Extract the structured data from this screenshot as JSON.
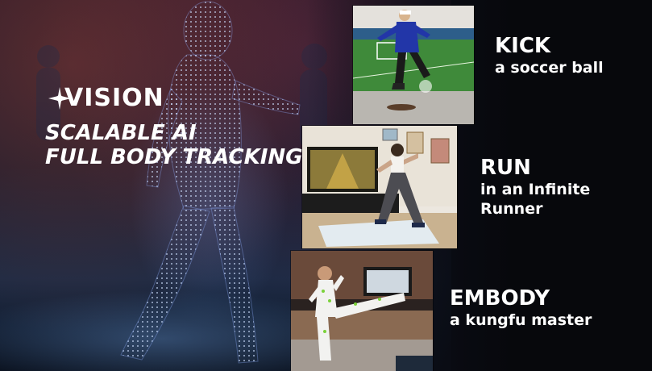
{
  "brand": {
    "logo_text": "VISION",
    "logo_icon": "sparkle-icon"
  },
  "tagline": {
    "line1": "SCALABLE AI",
    "line2": "FULL BODY TRACKING"
  },
  "activities": [
    {
      "title": "KICK",
      "subtitle_lines": [
        "a soccer ball"
      ],
      "photo": "soccer-kick-photo"
    },
    {
      "title": "RUN",
      "subtitle_lines": [
        "in an Infinite",
        "Runner"
      ],
      "photo": "living-room-runner-photo"
    },
    {
      "title": "EMBODY",
      "subtitle_lines": [
        "a kungfu master"
      ],
      "photo": "kungfu-kick-photo"
    }
  ],
  "colors": {
    "background": "#0a0c14",
    "text": "#ffffff",
    "grass": "#3f8a3a",
    "jersey": "#2236a8"
  }
}
